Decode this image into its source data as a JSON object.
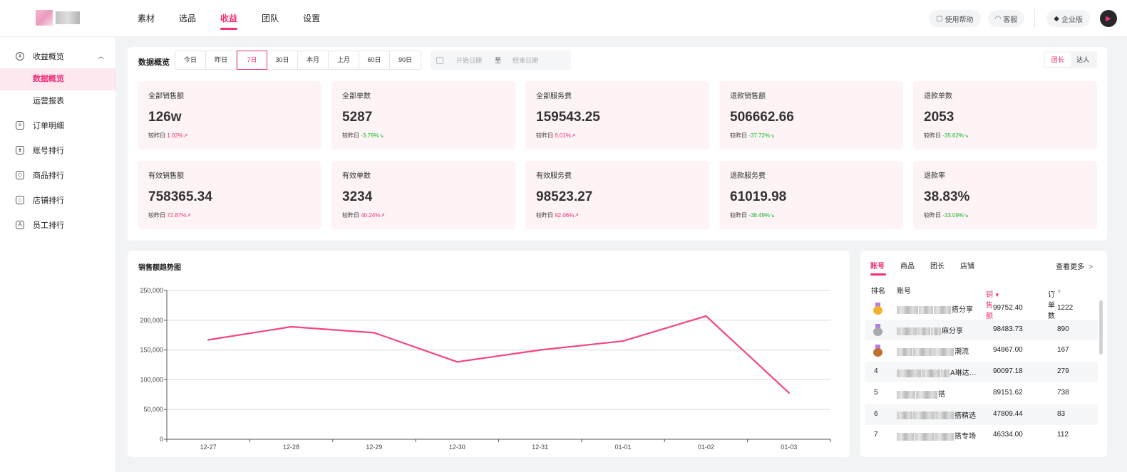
{
  "topnav": {
    "items": [
      "素材",
      "选品",
      "收益",
      "团队",
      "设置"
    ],
    "active": 2
  },
  "topright": {
    "help": "使用帮助",
    "service": "客服",
    "edition": "企业版"
  },
  "sidebar": {
    "group": "收益概览",
    "sub": [
      "数据概览",
      "运营报表"
    ],
    "items": [
      "订单明细",
      "账号排行",
      "商品排行",
      "店铺排行",
      "员工排行"
    ]
  },
  "overview": {
    "title": "数据概览",
    "date_tabs": [
      "今日",
      "昨日",
      "7日",
      "30日",
      "本月",
      "上月",
      "60日",
      "90日"
    ],
    "active_tab": 2,
    "date_range": {
      "start_placeholder": "开始日期",
      "to": "至",
      "end_placeholder": "结束日期"
    },
    "roles": [
      "团长",
      "达人"
    ],
    "compare_label": "较昨日",
    "cards": [
      {
        "label": "全部销售额",
        "value": "126w",
        "change": "1.02%↗",
        "trend": "up"
      },
      {
        "label": "全部单数",
        "value": "5287",
        "change": "-3.79%↘",
        "trend": "down"
      },
      {
        "label": "全部服务费",
        "value": "159543.25",
        "change": "6.01%↗",
        "trend": "up"
      },
      {
        "label": "退款销售额",
        "value": "506662.66",
        "change": "-37.72%↘",
        "trend": "down"
      },
      {
        "label": "退款单数",
        "value": "2053",
        "change": "-35.62%↘",
        "trend": "down"
      },
      {
        "label": "有效销售额",
        "value": "758365.34",
        "change": "72.87%↗",
        "trend": "up"
      },
      {
        "label": "有效单数",
        "value": "3234",
        "change": "40.24%↗",
        "trend": "up"
      },
      {
        "label": "有效服务费",
        "value": "98523.27",
        "change": "92.06%↗",
        "trend": "up"
      },
      {
        "label": "退款服务费",
        "value": "61019.98",
        "change": "-38.49%↘",
        "trend": "down"
      },
      {
        "label": "退款率",
        "value": "38.83%",
        "change": "-33.09%↘",
        "trend": "down"
      }
    ]
  },
  "chart_data": {
    "type": "line",
    "title": "销售额趋势图",
    "categories": [
      "12-27",
      "12-28",
      "12-29",
      "12-30",
      "12-31",
      "01-01",
      "01-02",
      "01-03"
    ],
    "series": [
      {
        "values": [
          167000,
          189000,
          179000,
          130000,
          150000,
          165000,
          207000,
          78000
        ]
      }
    ],
    "ylim": [
      0,
      250000
    ],
    "yticks": [
      "0",
      "50,000",
      "100,000",
      "150,000",
      "200,000",
      "250,000"
    ],
    "grid": true,
    "color": "#f5467f"
  },
  "ranking": {
    "tabs": [
      "账号",
      "商品",
      "团长",
      "店铺"
    ],
    "active_tab": 0,
    "more": "查看更多",
    "headers": {
      "rank": "排名",
      "account": "账号",
      "sales": "销售额",
      "orders": "订单数"
    },
    "rows": [
      {
        "rank": "1",
        "medal": "gold",
        "name": "搭分享",
        "sales": "99752.40",
        "orders": "1222"
      },
      {
        "rank": "2",
        "medal": "silver",
        "name": "麻分享",
        "sales": "98483.73",
        "orders": "890"
      },
      {
        "rank": "3",
        "medal": "bronze",
        "name": "潮流",
        "sales": "94867.00",
        "orders": "167"
      },
      {
        "rank": "4",
        "medal": "",
        "name": "A琳达…",
        "sales": "90097.18",
        "orders": "279"
      },
      {
        "rank": "5",
        "medal": "",
        "name": "搭",
        "sales": "89151.62",
        "orders": "738"
      },
      {
        "rank": "6",
        "medal": "",
        "name": "搭精选",
        "sales": "47809.44",
        "orders": "83"
      },
      {
        "rank": "7",
        "medal": "",
        "name": "搭专场",
        "sales": "46334.00",
        "orders": "112"
      }
    ]
  }
}
